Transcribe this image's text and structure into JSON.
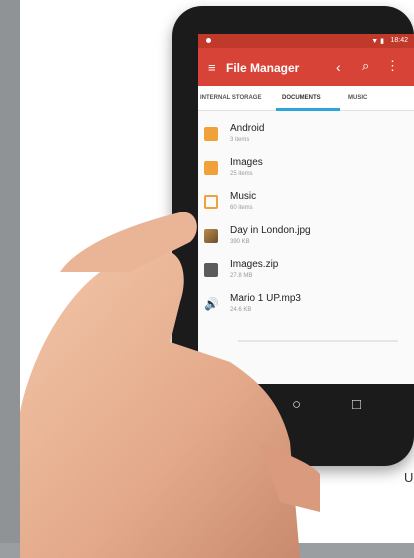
{
  "status_bar": {
    "time": "18:42",
    "signal": "▼ ▮"
  },
  "app_bar": {
    "title": "File Manager",
    "menu_icon": "≡",
    "back_icon": "‹",
    "search_icon": "⌕",
    "more_icon": "⋮"
  },
  "tabs": [
    {
      "label": "INTERNAL STORAGE"
    },
    {
      "label": "DOCUMENTS"
    },
    {
      "label": "MUSIC"
    }
  ],
  "files": [
    {
      "name": "Android",
      "meta": "3 items",
      "icon": "folder-icon"
    },
    {
      "name": "Images",
      "meta": "25 items",
      "icon": "folder-icon"
    },
    {
      "name": "Music",
      "meta": "60 items",
      "icon": "folder-outline-icon"
    },
    {
      "name": "Day in London.jpg",
      "meta": "390 KB",
      "icon": "image-icon"
    },
    {
      "name": "Images.zip",
      "meta": "27.8 MB",
      "icon": "archive-icon"
    },
    {
      "name": "Mario 1 UP.mp3",
      "meta": "24.6 KB",
      "icon": "audio-icon"
    }
  ],
  "nav_bar": {
    "back": "◁",
    "home": "○",
    "recent": "□"
  },
  "colors": {
    "accent": "#d84337",
    "tab_indicator": "#2aa7d8",
    "folder": "#f0a13a"
  },
  "edge_text": "U"
}
